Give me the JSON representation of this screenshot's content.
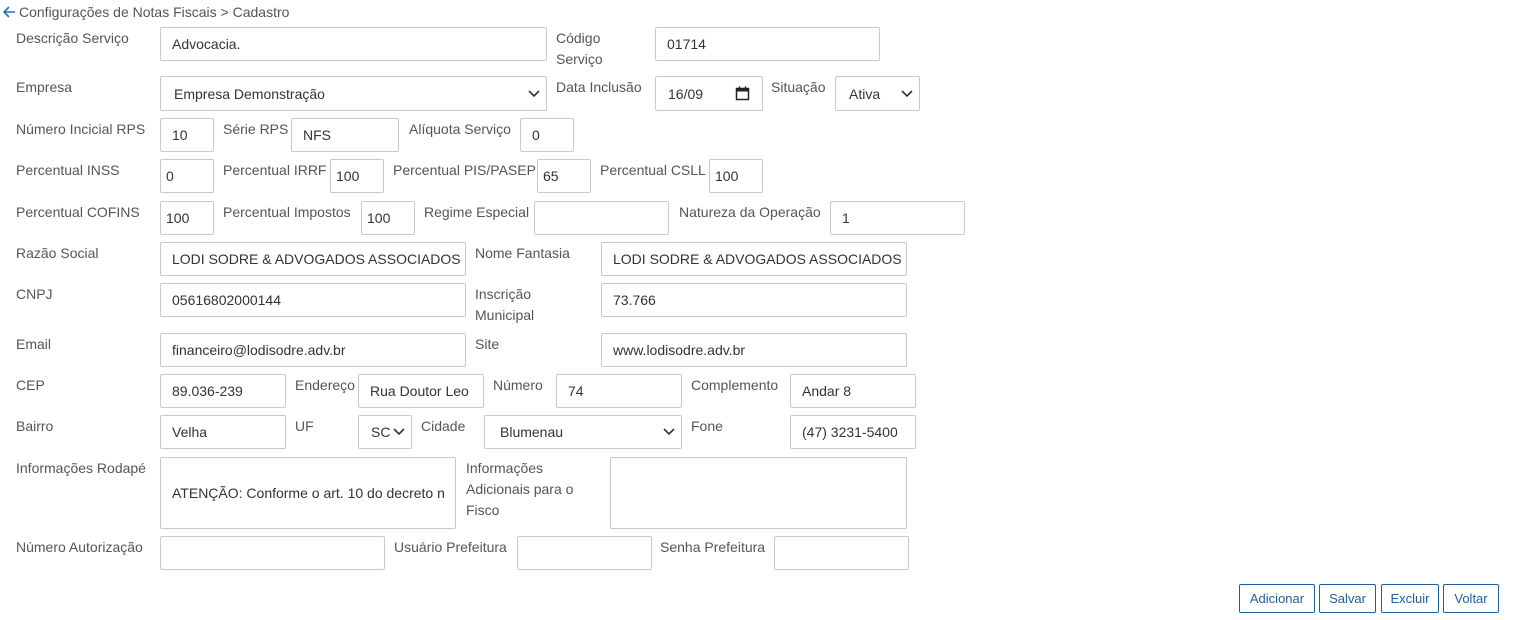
{
  "breadcrumb": {
    "text": "Configurações de Notas Fiscais > Cadastro"
  },
  "labels": {
    "descricao_servico": "Descrição Serviço",
    "codigo_servico_1": "Código",
    "codigo_servico_2": "Serviço",
    "empresa": "Empresa",
    "data_inclusao": "Data Inclusão",
    "situacao": "Situação",
    "numero_inicial_rps": "Número Incicial RPS",
    "serie_rps": "Série RPS",
    "aliquota_servico": "Alíquota Serviço",
    "percentual_inss": "Percentual INSS",
    "percentual_irrf": "Percentual IRRF",
    "percentual_pis": "Percentual PIS/PASEP",
    "percentual_csll": "Percentual CSLL",
    "percentual_cofins": "Percentual COFINS",
    "percentual_impostos": "Percentual Impostos",
    "regime_especial": "Regime Especial",
    "natureza_operacao": "Natureza da Operação",
    "razao_social": "Razão Social",
    "nome_fantasia": "Nome Fantasia",
    "cnpj": "CNPJ",
    "inscricao_1": "Inscrição",
    "inscricao_2": "Municipal",
    "email": "Email",
    "site": "Site",
    "cep": "CEP",
    "endereco": "Endereço",
    "numero": "Número",
    "complemento": "Complemento",
    "bairro": "Bairro",
    "uf": "UF",
    "cidade": "Cidade",
    "fone": "Fone",
    "info_rodape": "Informações Rodapé",
    "info_adic_1": "Informações",
    "info_adic_2": "Adicionais para o",
    "info_adic_3": "Fisco",
    "numero_autorizacao": "Número Autorização",
    "usuario_prefeitura": "Usuário Prefeitura",
    "senha_prefeitura": "Senha Prefeitura"
  },
  "values": {
    "descricao_servico": "Advocacia.",
    "codigo_servico": "01714",
    "empresa": "Empresa Demonstração",
    "data_inclusao": "16/09",
    "situacao": "Ativa",
    "numero_inicial_rps": "10",
    "serie_rps": "NFS",
    "aliquota_servico": "0",
    "percentual_inss": "0",
    "percentual_irrf": "100",
    "percentual_pis": "65",
    "percentual_csll": "100",
    "percentual_cofins": "100",
    "percentual_impostos": "100",
    "regime_especial": "",
    "natureza_operacao": "1",
    "razao_social": "LODI SODRE & ADVOGADOS ASSOCIADOS",
    "nome_fantasia": "LODI SODRE & ADVOGADOS ASSOCIADOS",
    "cnpj": "05616802000144",
    "inscricao_municipal": "73.766",
    "email": "financeiro@lodisodre.adv.br",
    "site": "www.lodisodre.adv.br",
    "cep": "89.036-239",
    "endereco": "Rua Doutor Leo",
    "numero": "74",
    "complemento": "Andar 8",
    "bairro": "Velha",
    "uf": "SC",
    "cidade": "Blumenau",
    "fone": "(47) 3231-5400",
    "info_rodape": "ATENÇÃO: Conforme o art. 10 do decreto n",
    "info_adicionais": "",
    "numero_autorizacao": "",
    "usuario_prefeitura": "",
    "senha_prefeitura": ""
  },
  "buttons": {
    "adicionar": "Adicionar",
    "salvar": "Salvar",
    "excluir": "Excluir",
    "voltar": "Voltar"
  },
  "colors": {
    "button_border": "#1f5f9c",
    "back_arrow": "#1f6fbf"
  },
  "icons": {
    "back": "arrow-left-icon",
    "dropdown": "chevron-down-icon",
    "calendar": "calendar-icon"
  }
}
